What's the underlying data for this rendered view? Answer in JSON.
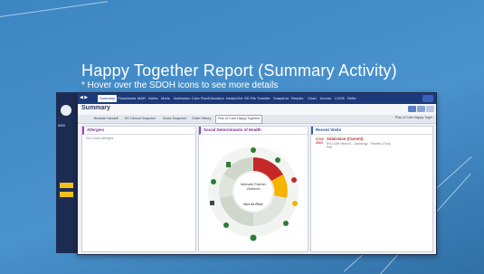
{
  "slide": {
    "title": "Happy Together Report (Summary Activity)",
    "subtitle": "* Hover over the SDOH icons to see more details"
  },
  "topbar": {
    "items": [
      "Summary",
      "Flowsheets",
      "MAR",
      "Notes",
      "Meds",
      "Admission",
      "Care Plan",
      "Education",
      "Intake/Out",
      "SD Fils",
      "Transfer",
      "Snapshot",
      "Results",
      "Chart",
      "Immun",
      "LOOK",
      "Refer"
    ]
  },
  "header": {
    "title": "Summary"
  },
  "tabs": {
    "items": [
      "Bedside Handoff",
      "ED Clinical Snapshot",
      "Nurse Snapshot",
      "Order History",
      "Plan of Care Happy Together"
    ],
    "right_label": "Plan of Care Happy Toget"
  },
  "allergies": {
    "title": "Allergies",
    "body": "No Known Allergies"
  },
  "sdoh": {
    "title": "Social Determinants of Health",
    "center_label": "Intimate Partner Violence",
    "center_status": "Not At Risk"
  },
  "visits": {
    "title": "Recent Visits",
    "date": "07/19 2022",
    "visit_title": "Admission (Current)",
    "visit_line1": "NYU LMH Heart M... Cardiology - Tinsmith & Sonj",
    "visit_line2": "PMT"
  },
  "colors": {
    "ring_red": "#c62828",
    "ring_yellow": "#f4b400",
    "ring_green": "#4caf50",
    "ring_gray": "#c8cdd3"
  }
}
